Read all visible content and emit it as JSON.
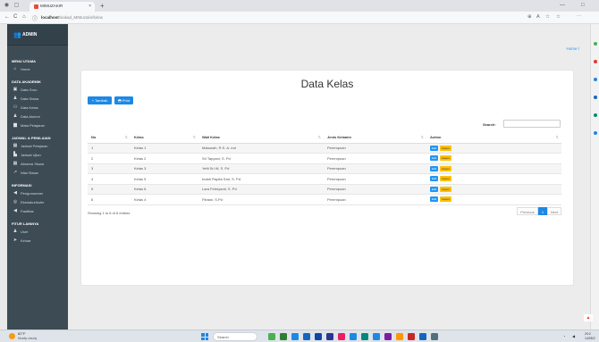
{
  "browser": {
    "tab_title": "MIMUZAKIR",
    "tab_close": "×",
    "new_tab": "+",
    "url_host": "localhost",
    "url_path": "/siakad_MIMuzakir/kelas",
    "nav": {
      "back": "←",
      "refresh": "C",
      "home": "⌂",
      "info": "ⓘ"
    },
    "window": {
      "minimize": "—",
      "restore": "□"
    },
    "toolbar_icons": [
      "⊕",
      "A",
      "☆",
      "☆",
      "⋯"
    ]
  },
  "sidebar": {
    "brand": "ADMIN",
    "sections": [
      {
        "title": "MENU UTAMA",
        "items": [
          {
            "label": "Home",
            "icon": "home-icon"
          }
        ]
      },
      {
        "title": "DATA AKADEMIK",
        "items": [
          {
            "label": "Data Guru",
            "icon": "teacher-icon"
          },
          {
            "label": "Data Siswa",
            "icon": "student-icon"
          },
          {
            "label": "Data Kelas",
            "icon": "users-icon"
          },
          {
            "label": "Data Alumni",
            "icon": "alumni-icon"
          },
          {
            "label": "Mata Pelajaran",
            "icon": "book-icon"
          }
        ]
      },
      {
        "title": "JADWAL & PENILAIAN",
        "items": [
          {
            "label": "Jadwal Pelajaran",
            "icon": "calendar-icon"
          },
          {
            "label": "Jadwal Ujian",
            "icon": "exam-icon"
          },
          {
            "label": "Absensi Siswa",
            "icon": "attendance-icon"
          },
          {
            "label": "Nilai Siswa",
            "icon": "chart-icon"
          }
        ]
      },
      {
        "title": "INFORMASI",
        "items": [
          {
            "label": "Pengumuman",
            "icon": "megaphone-icon"
          },
          {
            "label": "Ekstrakurikuler",
            "icon": "activity-icon"
          },
          {
            "label": "Fasilitas",
            "icon": "building-icon"
          }
        ]
      },
      {
        "title": "FITUR LAINNYA",
        "items": [
          {
            "label": "User",
            "icon": "user-icon"
          },
          {
            "label": "Keluar",
            "icon": "logout-icon"
          }
        ]
      }
    ]
  },
  "breadcrumb": "Home /",
  "page": {
    "title": "Data Kelas",
    "add_button": "+ Tambah Data",
    "print_button": "🖶 Print",
    "search_label": "Search:",
    "search_value": "",
    "columns": [
      "No",
      "Kelas",
      "Wali Kelas",
      "Jenis Kelamin",
      "Action"
    ],
    "rows": [
      {
        "no": "1",
        "kelas": "Kelas 1",
        "wali": "Maisarah, R.S. A. md",
        "jk": "Perempuan"
      },
      {
        "no": "2",
        "kelas": "Kelas 2",
        "wali": "Sri Tapyani, S. Pd",
        "jk": "Perempuan"
      },
      {
        "no": "3",
        "kelas": "Kelas 3",
        "wali": "Yefti Sri W, S. Pd",
        "jk": "Perempuan"
      },
      {
        "no": "4",
        "kelas": "Kelas 5",
        "wali": "Indah Rapita Sari, S. Pd",
        "jk": "Perempuan"
      },
      {
        "no": "5",
        "kelas": "Kelas 6",
        "wali": "Lara Febriyanti, S. Pd",
        "jk": "Perempuan"
      },
      {
        "no": "6",
        "kelas": "Kelas 4",
        "wali": "Fitriani, S.Pd",
        "jk": "Perempuan"
      }
    ],
    "edit_label": "Edit",
    "delete_label": "Hapus",
    "showing": "Showing 1 to 6 of 6 entries",
    "pagination": {
      "previous": "Previous",
      "current": "1",
      "next": "Next"
    }
  },
  "taskbar": {
    "temp": "82°F",
    "condition": "Mostly cloudy",
    "search": "Search",
    "time": "20:2",
    "date": "14/05/2"
  },
  "colors": {
    "primary": "#1e88e5",
    "warning": "#ffc107",
    "sidebar": "#3c4b54"
  }
}
